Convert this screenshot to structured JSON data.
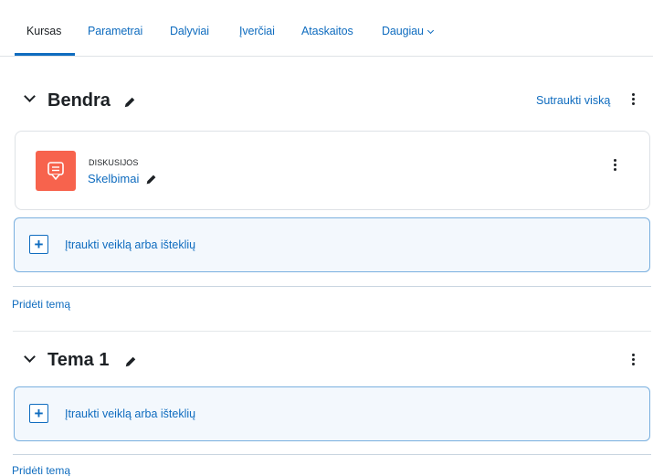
{
  "tabs": [
    {
      "label": "Kursas",
      "active": true
    },
    {
      "label": "Parametrai"
    },
    {
      "label": "Dalyviai"
    },
    {
      "label": "Įverčiai"
    },
    {
      "label": "Ataskaitos"
    },
    {
      "label": "Daugiau"
    }
  ],
  "sections": [
    {
      "title": "Bendra",
      "collapse_all": "Sutraukti viską",
      "activities": [
        {
          "type": "DISKUSIJOS",
          "name": "Skelbimai",
          "icon": "forum-icon"
        }
      ],
      "add_activity": "Įtraukti veiklą arba išteklių",
      "add_topic": "Pridėti temą"
    },
    {
      "title": "Tema 1",
      "add_activity": "Įtraukti veiklą arba išteklių",
      "add_topic": "Pridėti temą"
    }
  ],
  "colors": {
    "accent": "#0f6cbf",
    "forum": "#f7634d",
    "text": "#1d2125"
  }
}
